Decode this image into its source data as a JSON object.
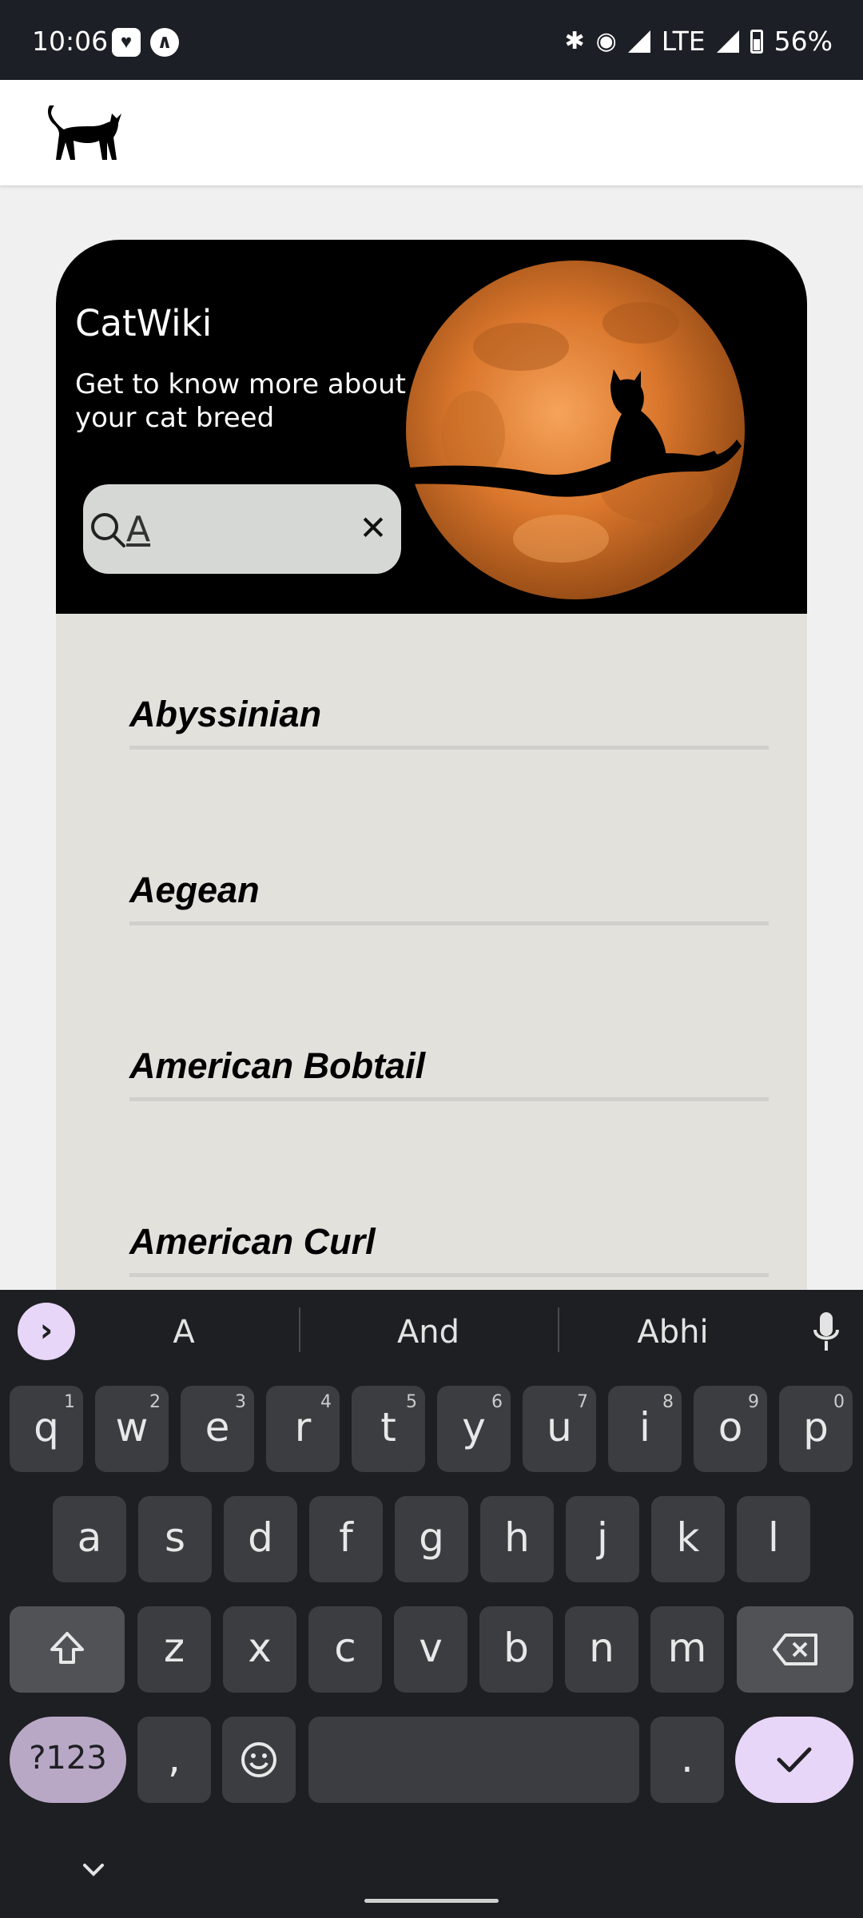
{
  "status_bar": {
    "time": "10:06",
    "network": "LTE",
    "battery": "56%"
  },
  "app": {
    "title": "CatWiki",
    "subtitle": "Get to know more about\n your cat breed"
  },
  "search": {
    "value": "A"
  },
  "breeds": [
    {
      "name": "Abyssinian"
    },
    {
      "name": "Aegean"
    },
    {
      "name": "American Bobtail"
    },
    {
      "name": "American Curl"
    }
  ],
  "keyboard": {
    "suggestions": [
      "A",
      "And",
      "Abhi"
    ],
    "row1": [
      {
        "k": "q",
        "n": "1"
      },
      {
        "k": "w",
        "n": "2"
      },
      {
        "k": "e",
        "n": "3"
      },
      {
        "k": "r",
        "n": "4"
      },
      {
        "k": "t",
        "n": "5"
      },
      {
        "k": "y",
        "n": "6"
      },
      {
        "k": "u",
        "n": "7"
      },
      {
        "k": "i",
        "n": "8"
      },
      {
        "k": "o",
        "n": "9"
      },
      {
        "k": "p",
        "n": "0"
      }
    ],
    "row2": [
      "a",
      "s",
      "d",
      "f",
      "g",
      "h",
      "j",
      "k",
      "l"
    ],
    "row3": [
      "z",
      "x",
      "c",
      "v",
      "b",
      "n",
      "m"
    ],
    "symbols_label": "?123",
    "comma": ",",
    "period": "."
  },
  "colors": {
    "hero_bg": "#000000",
    "card_bg": "#e2e1dc",
    "keyboard_bg": "#1e1f22",
    "accent": "#e8d6f8"
  }
}
